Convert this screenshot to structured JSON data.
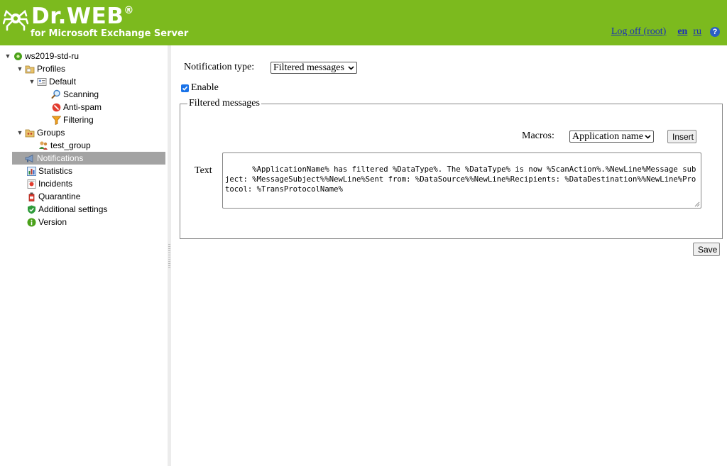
{
  "header": {
    "brand": "Dr.WEB",
    "brand_mark": "®",
    "product": "for Microsoft Exchange Server",
    "logoff": "Log off (root)",
    "lang_en": "en",
    "lang_ru": "ru",
    "help": "?"
  },
  "sidebar": {
    "server": "ws2019-std-ru",
    "profiles": "Profiles",
    "default": "Default",
    "scanning": "Scanning",
    "antispam": "Anti-spam",
    "filtering": "Filtering",
    "groups": "Groups",
    "test_group": "test_group",
    "notifications": "Notifications",
    "statistics": "Statistics",
    "incidents": "Incidents",
    "quarantine": "Quarantine",
    "additional_settings": "Additional settings",
    "version": "Version"
  },
  "form": {
    "notification_type_label": "Notification type:",
    "notification_type_value": "Filtered messages",
    "enable_label": "Enable",
    "enable_checked": true,
    "fieldset_legend": "Filtered messages",
    "macros_label": "Macros:",
    "macros_value": "Application name",
    "insert_label": "Insert",
    "text_label": "Text",
    "text_value": "%ApplicationName% has filtered %DataType%. The %DataType% is now %ScanAction%.%NewLine%Message subject: %MessageSubject%%NewLine%Sent from: %DataSource%%NewLine%Recipients: %DataDestination%%NewLine%Protocol: %TransProtocolName%",
    "save_label": "Save"
  },
  "colors": {
    "header_green": "#7cba1e",
    "selected_row": "#a3a3a3",
    "link_blue": "#1a2fb8",
    "checkbox_blue": "#1a73e8"
  }
}
